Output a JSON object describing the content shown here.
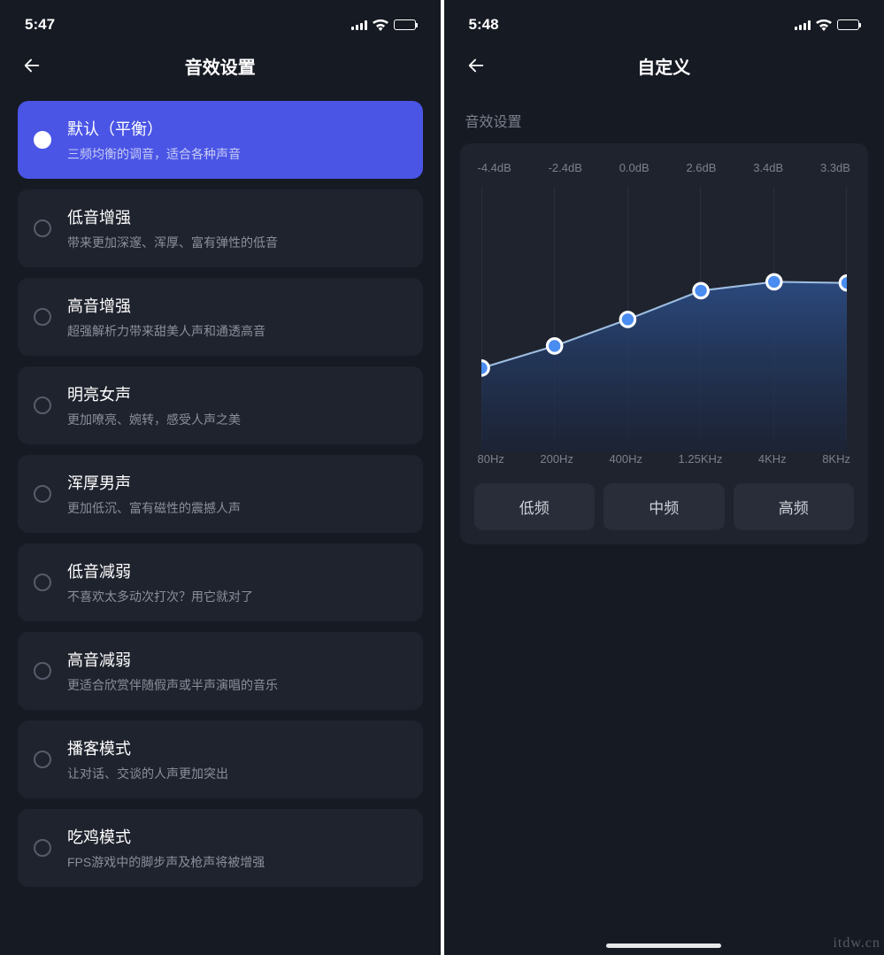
{
  "left": {
    "time": "5:47",
    "title": "音效设置",
    "presets": [
      {
        "title": "默认（平衡）",
        "sub": "三频均衡的调音，适合各种声音",
        "selected": true
      },
      {
        "title": "低音增强",
        "sub": "带来更加深邃、浑厚、富有弹性的低音",
        "selected": false
      },
      {
        "title": "高音增强",
        "sub": "超强解析力带来甜美人声和通透高音",
        "selected": false
      },
      {
        "title": "明亮女声",
        "sub": "更加嘹亮、婉转，感受人声之美",
        "selected": false
      },
      {
        "title": "浑厚男声",
        "sub": "更加低沉、富有磁性的震撼人声",
        "selected": false
      },
      {
        "title": "低音减弱",
        "sub": "不喜欢太多动次打次？用它就对了",
        "selected": false
      },
      {
        "title": "高音减弱",
        "sub": "更适合欣赏伴随假声或半声演唱的音乐",
        "selected": false
      },
      {
        "title": "播客模式",
        "sub": "让对话、交谈的人声更加突出",
        "selected": false
      },
      {
        "title": "吃鸡模式",
        "sub": "FPS游戏中的脚步声及枪声将被增强",
        "selected": false
      }
    ]
  },
  "right": {
    "time": "5:48",
    "title": "自定义",
    "section_label": "音效设置",
    "tabs": [
      "低频",
      "中频",
      "高频"
    ]
  },
  "chart_data": {
    "type": "line",
    "categories": [
      "80Hz",
      "200Hz",
      "400Hz",
      "1.25KHz",
      "4KHz",
      "8KHz"
    ],
    "values": [
      -4.4,
      -2.4,
      0.0,
      2.6,
      3.4,
      3.3
    ],
    "labels_db": [
      "-4.4dB",
      "-2.4dB",
      "0.0dB",
      "2.6dB",
      "3.4dB",
      "3.3dB"
    ],
    "title": "音效设置",
    "xlabel": "",
    "ylabel": "dB",
    "ylim": [
      -12,
      12
    ]
  },
  "watermark": "itdw.cn"
}
